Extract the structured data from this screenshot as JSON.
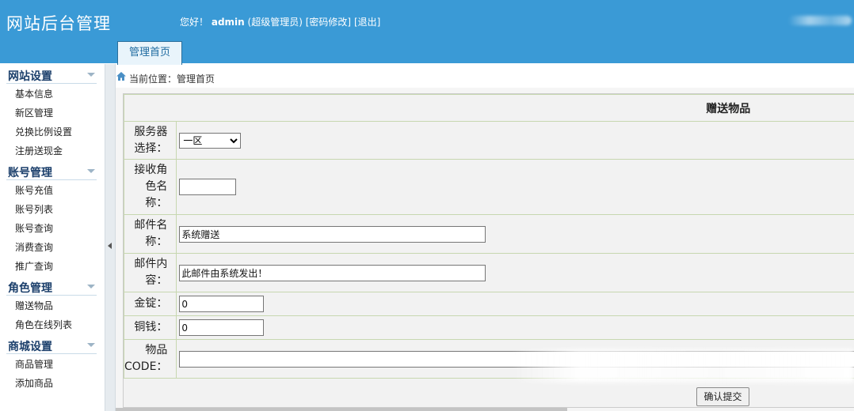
{
  "header": {
    "site_title": "网站后台管理",
    "greeting": "您好！",
    "username": "admin",
    "role": "(超级管理员)",
    "change_password": "[密码修改]",
    "logout": "[退出]",
    "home_tab": "管理首页"
  },
  "sidebar": {
    "sections": [
      {
        "title": "网站设置",
        "items": [
          "基本信息",
          "新区管理",
          "兑换比例设置",
          "注册送现金"
        ]
      },
      {
        "title": "账号管理",
        "items": [
          "账号充值",
          "账号列表",
          "账号查询",
          "消费查询",
          "推广查询"
        ]
      },
      {
        "title": "角色管理",
        "items": [
          "赠送物品",
          "角色在线列表"
        ]
      },
      {
        "title": "商城设置",
        "items": [
          "商品管理",
          "添加商品"
        ]
      }
    ]
  },
  "breadcrumb": "当前位置：管理首页",
  "form": {
    "caption": "赠送物品",
    "server_label_1": "服务器",
    "server_label_2": "选择：",
    "server_value": "一区",
    "role_label_1": "接收角",
    "role_label_2": "色名",
    "role_label_3": "称：",
    "role_value": "",
    "mail_name_label_1": "邮件名",
    "mail_name_label_2": "称：",
    "mail_name_value": "系统赠送",
    "mail_content_label_1": "邮件内",
    "mail_content_label_2": "容：",
    "mail_content_value": "此邮件由系统发出！",
    "gold_label": "金锭：",
    "gold_value": "0",
    "copper_label": "铜钱：",
    "copper_value": "0",
    "item_code_label_1": "物品",
    "item_code_label_2": "CODE：",
    "item_code_value": "",
    "submit_label": "确认提交"
  },
  "colors": {
    "header_bg": "#3a9ad6",
    "sidebar_heading": "#1b3f6b",
    "table_border": "#c7d7b0"
  },
  "icons": {
    "home": "home-icon",
    "collapse": "triangle-left-icon",
    "section_toggle": "chevron-down-icon"
  }
}
